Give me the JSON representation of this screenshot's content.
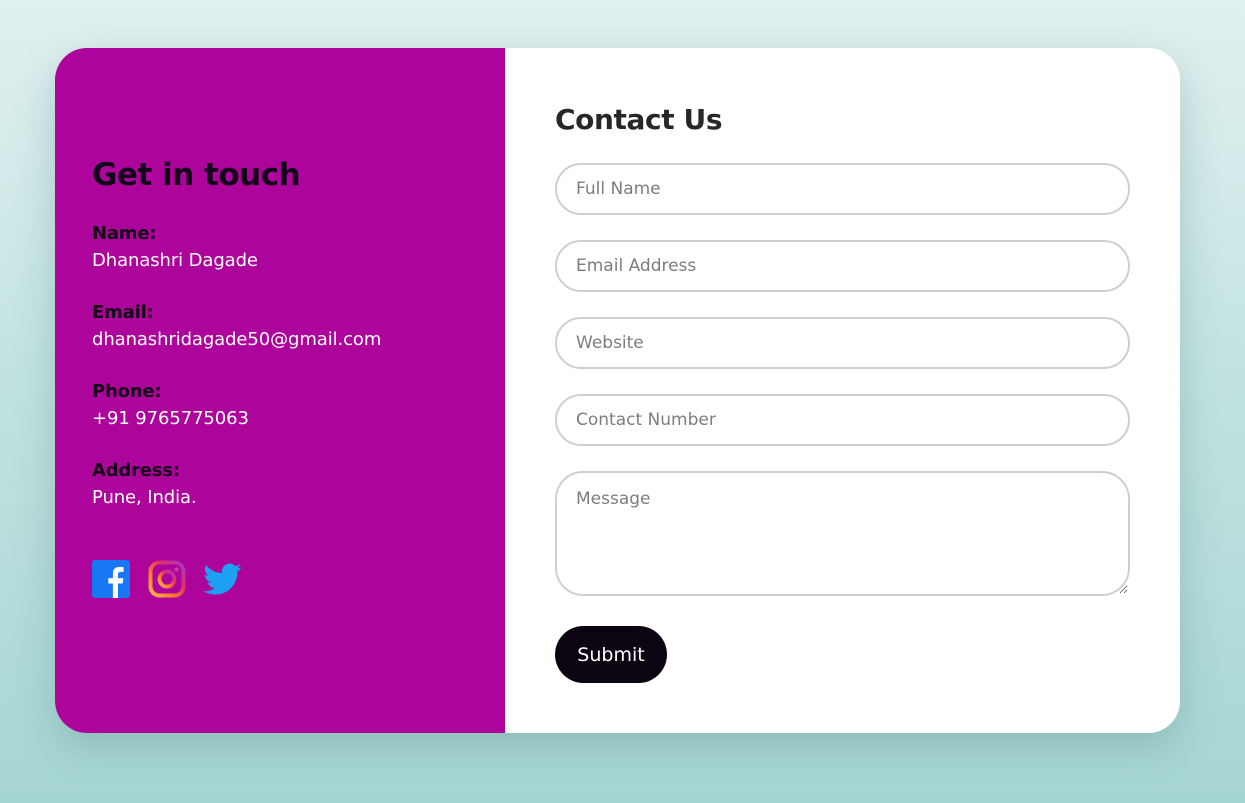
{
  "left_panel": {
    "heading": "Get in touch",
    "items": [
      {
        "label": "Name:",
        "value": "Dhanashri Dagade"
      },
      {
        "label": "Email:",
        "value": "dhanashridagade50@gmail.com"
      },
      {
        "label": "Phone:",
        "value": "+91 9765775063"
      },
      {
        "label": "Address:",
        "value": "Pune, India."
      }
    ],
    "socials": [
      "facebook-icon",
      "instagram-icon",
      "twitter-icon"
    ],
    "background_color": "#ad059b"
  },
  "form": {
    "heading": "Contact Us",
    "placeholders": {
      "full_name": "Full Name",
      "email": "Email Address",
      "website": "Website",
      "contact_number": "Contact Number",
      "message": "Message"
    },
    "submit_label": "Submit"
  }
}
